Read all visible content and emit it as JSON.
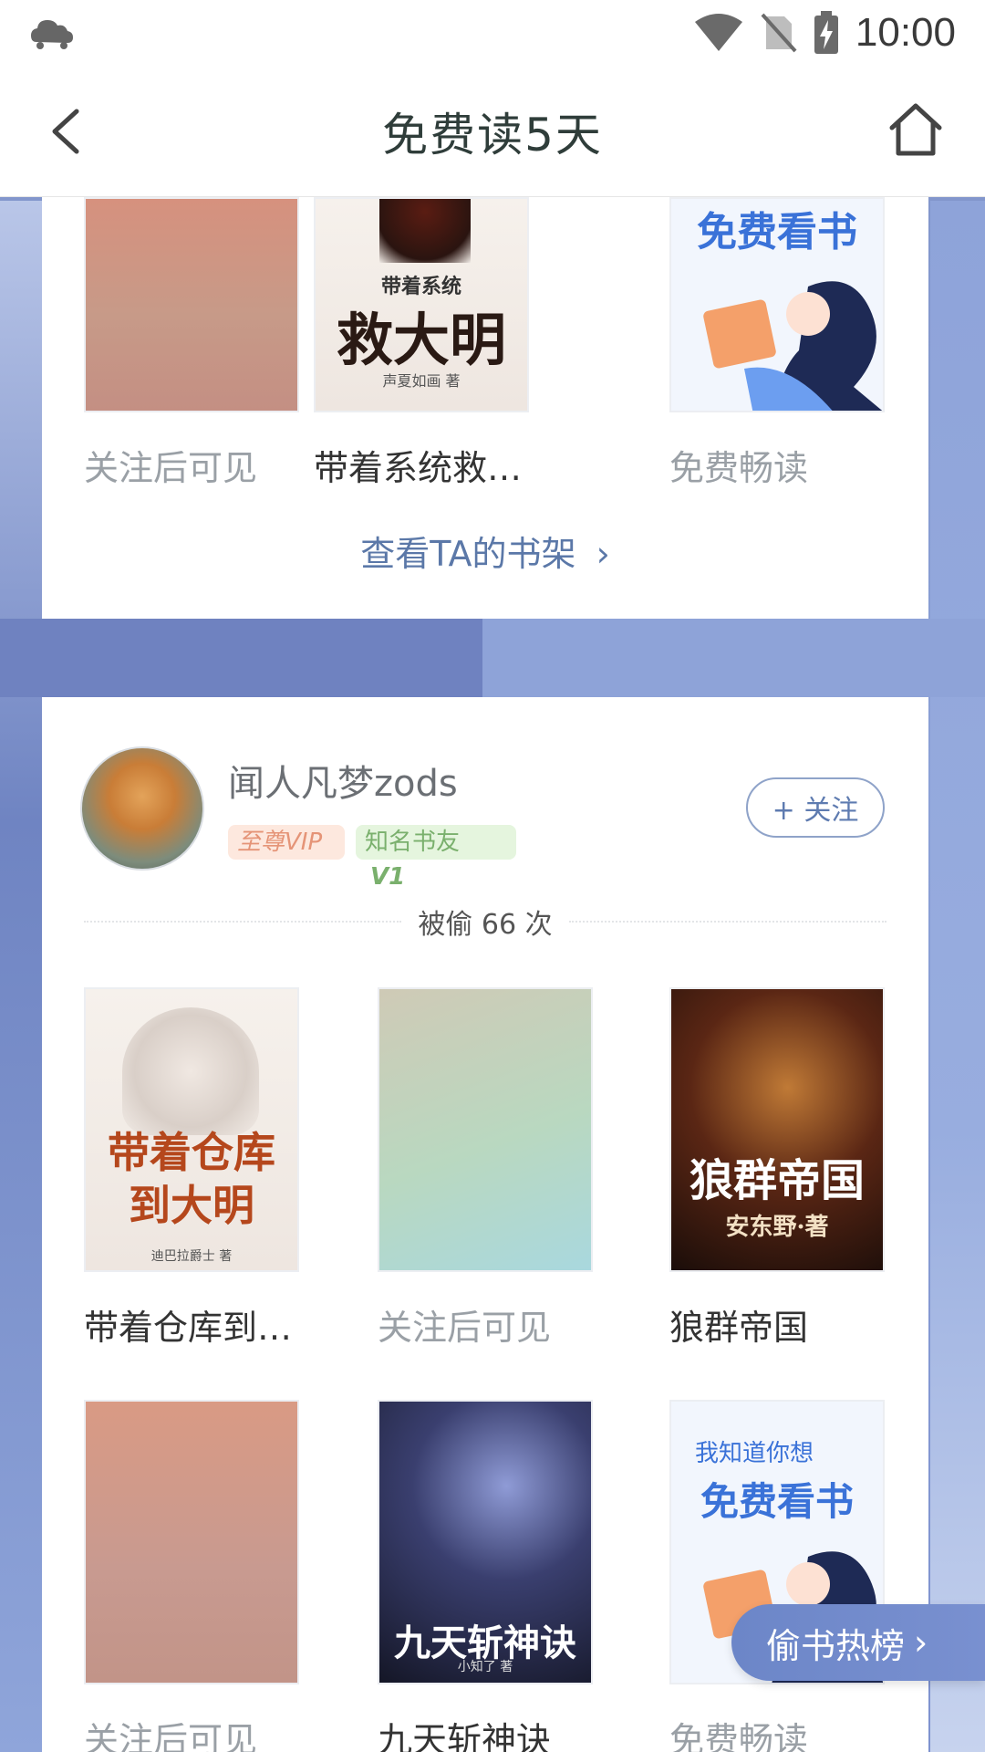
{
  "status_bar": {
    "time": "10:00",
    "icons": [
      "cloud-icon",
      "wifi-icon",
      "no-sim-icon",
      "battery-charging-icon"
    ]
  },
  "title_bar": {
    "title": "免费读5天",
    "back_icon": "chevron-left-icon",
    "home_icon": "home-icon"
  },
  "top_card": {
    "books": [
      {
        "title": "关注后可见",
        "muted": true
      },
      {
        "title": "带着系统救…",
        "muted": false,
        "cover_top_line": "带着系统",
        "cover_main": "救大明",
        "cover_author": "声夏如画 著"
      },
      {
        "title": "免费畅读",
        "muted": true,
        "cover_headline": "免费看书"
      }
    ],
    "view_shelf_label": "查看TA的书架"
  },
  "user_card": {
    "username": "闻人凡梦zods",
    "badges": {
      "vip": "至尊VIP",
      "friend": "知名书友",
      "friend_level": "V1"
    },
    "follow_label": "+ 关注",
    "stolen_count_text": "被偷 66 次",
    "books_row1": [
      {
        "title": "带着仓库到…",
        "muted": false,
        "cover_main": "带着仓库到大明",
        "cover_author": "迪巴拉爵士 著"
      },
      {
        "title": "关注后可见",
        "muted": true
      },
      {
        "title": "狼群帝国",
        "muted": false,
        "cover_main": "狼群帝国",
        "cover_author": "安东野·著"
      }
    ],
    "books_row2": [
      {
        "title": "关注后可见",
        "muted": true
      },
      {
        "title": "九天斩神诀",
        "muted": false,
        "cover_main": "九天斩神诀",
        "cover_author": "小知了 著"
      },
      {
        "title": "免费畅读",
        "muted": true,
        "cover_sub": "我知道你想",
        "cover_headline": "免费看书"
      }
    ]
  },
  "floating": {
    "rank_label": "偷书热榜"
  },
  "colors": {
    "accent": "#5b78a8",
    "muted_text": "#9aa0a6",
    "background": "#8aa0d6"
  }
}
